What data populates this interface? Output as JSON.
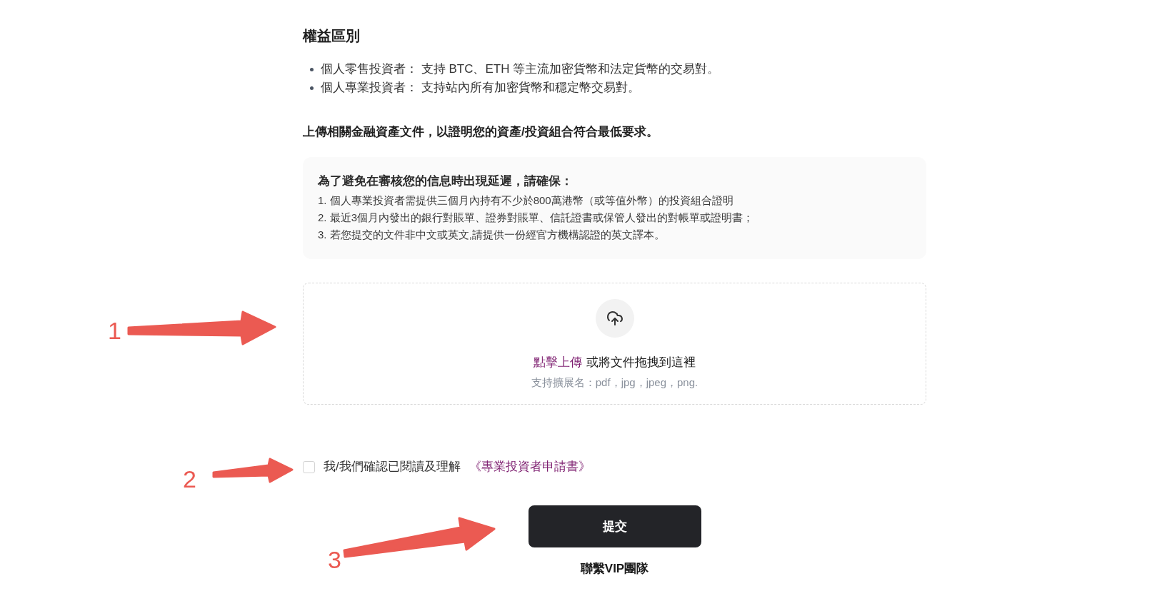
{
  "rights_section": {
    "title": "權益區別",
    "items": [
      "個人零售投資者： 支持 BTC、ETH 等主流加密貨幣和法定貨幣的交易對。",
      "個人專業投資者： 支持站內所有加密貨幣和穩定幣交易對。"
    ]
  },
  "upload_instruction": "上傳相關金融資產文件，以證明您的資產/投資組合符合最低要求。",
  "notice": {
    "title": "為了避免在審核您的信息時出現延遲，請確保：",
    "lines": [
      "1. 個人專業投資者需提供三個月內持有不少於800萬港幣（或等值外幣）的投資組合證明",
      "2. 最近3個月內發出的銀行對賬單、證券對賬單、信託證書或保管人發出的對帳單或證明書；",
      "3. 若您提交的文件非中文或英文,請提供一份經官方機構認證的英文譯本。"
    ]
  },
  "upload_area": {
    "link": "點擊上傳",
    "text": "或將文件拖拽到這裡",
    "hint": "支持擴展名：pdf，jpg，jpeg，png."
  },
  "agreement": {
    "checked": false,
    "text": "我/我們確認已閱讀及理解",
    "link": "《專業投資者申請書》"
  },
  "submit_button": "提交",
  "contact_link": "聯繫VIP團隊",
  "annotations": [
    {
      "label": "1"
    },
    {
      "label": "2"
    },
    {
      "label": "3"
    }
  ]
}
